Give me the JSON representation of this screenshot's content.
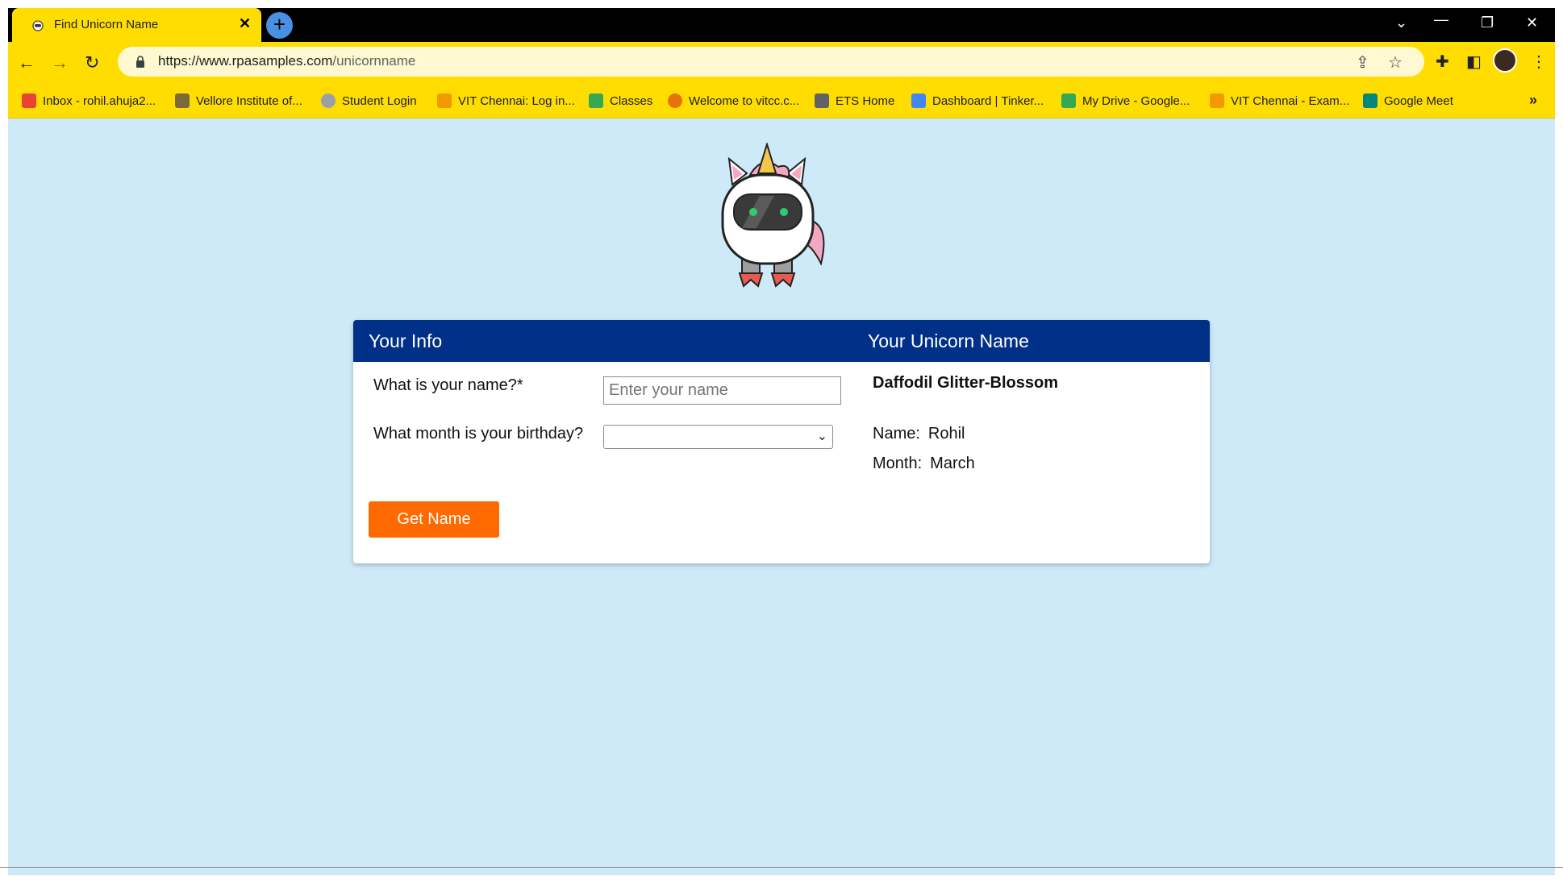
{
  "browser": {
    "tab_title": "Find Unicorn Name",
    "new_tab_label": "+",
    "url_domain": "https://www.rpasamples.com",
    "url_path": "/unicornname",
    "bookmarks": [
      {
        "label": "Inbox - rohil.ahuja2...",
        "color": "#ea4335"
      },
      {
        "label": "Vellore Institute of...",
        "color": "#7a6a3a"
      },
      {
        "label": "Student Login",
        "color": "#9aa0a6"
      },
      {
        "label": "VIT Chennai: Log in...",
        "color": "#f29900"
      },
      {
        "label": "Classes",
        "color": "#34a853"
      },
      {
        "label": "Welcome to vitcc.c...",
        "color": "#e8710a"
      },
      {
        "label": "ETS Home",
        "color": "#5f6368"
      },
      {
        "label": "Dashboard | Tinker...",
        "color": "#4285f4"
      },
      {
        "label": "My Drive - Google...",
        "color": "#34a853"
      },
      {
        "label": "VIT Chennai - Exam...",
        "color": "#f29900"
      },
      {
        "label": "Google Meet",
        "color": "#00897b"
      }
    ],
    "bookmarks_more": "»"
  },
  "form": {
    "header_left": "Your Info",
    "header_right": "Your Unicorn Name",
    "name_label": "What is your name?*",
    "name_placeholder": "Enter your name",
    "name_value": "",
    "month_label": "What month is your birthday?",
    "month_value": "",
    "submit_label": "Get Name"
  },
  "result": {
    "unicorn_name": "Daffodil Glitter-Blossom",
    "name_label": "Name:",
    "name_value": "Rohil",
    "month_label": "Month:",
    "month_value": "March"
  },
  "colors": {
    "chrome_accent": "#ffdd00",
    "header_bg": "#003087",
    "page_bg": "#ceeaf8",
    "button_bg": "#ff6a00"
  }
}
